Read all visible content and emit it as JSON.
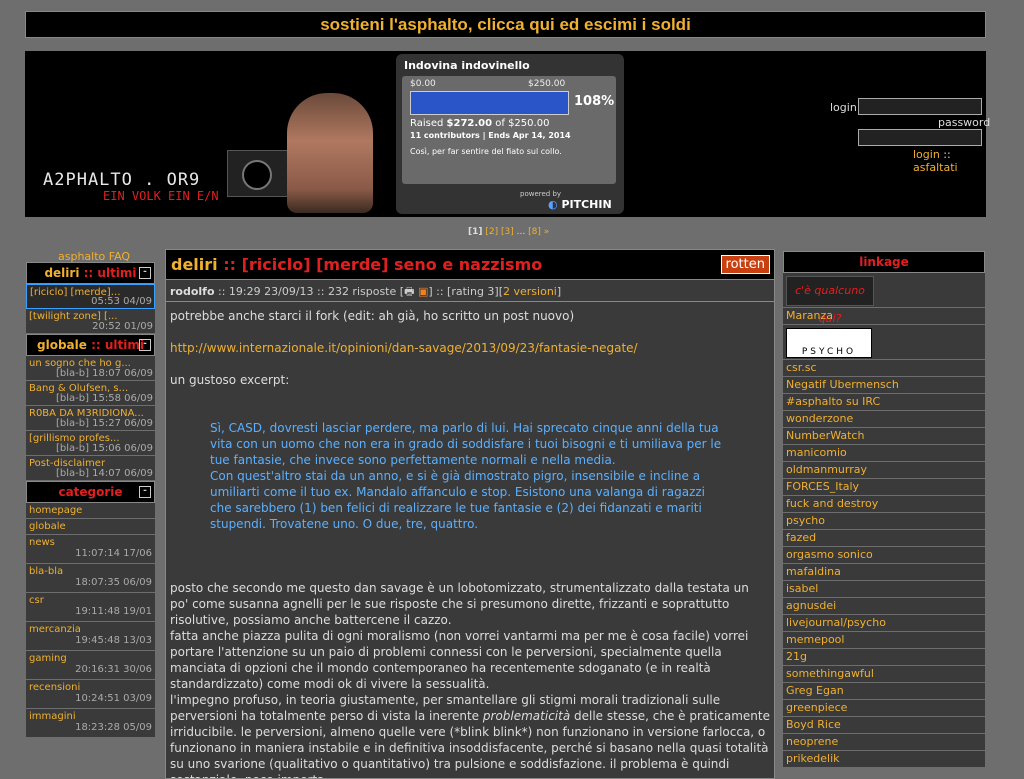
{
  "top_banner": "sostieni l'asphalto, clicca qui ed escimi i soldi",
  "logo": {
    "brand": "A2PHALTO . OR9",
    "slogan": "EIN VOLK EIN E/N"
  },
  "pitchin": {
    "title": "Indovina indovinello",
    "min": "$0.00",
    "max": "$250.00",
    "progress_percent": 108,
    "percent_label": "108%",
    "raised_prefix": "Raised ",
    "raised": "$272.00",
    "raised_suffix": " of $250.00",
    "contributors": "11 contributors | Ends Apr 14, 2014",
    "description": "Così, per far sentire del fiato sul collo.",
    "powered": "powered by",
    "brand": "PITCHIN"
  },
  "login": {
    "login_label": "login",
    "password_label": "password",
    "login_link": "login",
    "sep": " :: ",
    "register_link": "asfaltati"
  },
  "pager": {
    "current": "[1]",
    "pages": [
      "[2]",
      "[3]",
      "...",
      "[8]",
      "»"
    ]
  },
  "faq": "asphalto FAQ",
  "deliri_box": {
    "title_a": "deliri",
    "title_b": " :: ultimi",
    "items": [
      {
        "title": "[riciclo] [merde]…",
        "meta": "05:53 04/09"
      },
      {
        "title": "[twilight zone] [...",
        "meta": "20:52 01/09"
      }
    ]
  },
  "globale_box": {
    "title_a": "globale",
    "title_b": " :: ultimi",
    "items": [
      {
        "title": "un sogno che ho g...",
        "meta": "[bla-b] 18:07 06/09"
      },
      {
        "title": "Bang & Olufsen, s...",
        "meta": "[bla-b] 15:58 06/09"
      },
      {
        "title": "R0BA DA M3RIDIONA...",
        "meta": "[bla-b] 15:27 06/09"
      },
      {
        "title": "[grillismo profes...",
        "meta": "[bla-b] 15:06 06/09"
      },
      {
        "title": "Post-disclaimer",
        "meta": "[bla-b] 14:07 06/09"
      }
    ]
  },
  "categorie_box": {
    "title": "categorie",
    "items": [
      {
        "name": "homepage",
        "meta": ""
      },
      {
        "name": "globale",
        "meta": ""
      },
      {
        "name": "news",
        "meta": "11:07:14 17/06"
      },
      {
        "name": "bla-bla",
        "meta": "18:07:35 06/09"
      },
      {
        "name": "csr",
        "meta": "19:11:48 19/01"
      },
      {
        "name": "mercanzia",
        "meta": "19:45:48 13/03"
      },
      {
        "name": "gaming",
        "meta": "20:16:31 30/06"
      },
      {
        "name": "recensioni",
        "meta": "10:24:51 03/09"
      },
      {
        "name": "immagini",
        "meta": "18:23:28 05/09"
      }
    ]
  },
  "post": {
    "title_a": "deliri",
    "title_b": " :: [riciclo] [merde] seno e nazzismo",
    "rating_badge": "rotten",
    "author": "rodolfo",
    "meta": " :: 19:29 23/09/13 :: 232 risposte [",
    "meta2": "] :: [rating 3][",
    "versions": "2 versioni",
    "meta3": "]",
    "p1": "potrebbe anche starci il fork (edit: ah già, ho scritto un post nuovo)",
    "url": "http://www.internazionale.it/opinioni/dan-savage/2013/09/23/fantasie-negate/",
    "p2": "un gustoso excerpt:",
    "quote1": "Sì, CASD, dovresti lasciar perdere, ma parlo di lui. Hai sprecato cinque anni della tua vita con un uomo che non era in grado di soddisfare i tuoi bisogni e ti umiliava per le tue fantasie, che invece sono perfettamente normali e nella media.",
    "quote2": "Con quest'altro stai da un anno, e si è già dimostrato pigro, insensibile e incline a umiliarti come il tuo ex. Mandalo affanculo e stop. Esistono una valanga di ragazzi che sarebbero (1) ben felici di realizzare le tue fantasie e (2) dei fidanzati e mariti stupendi. Trovatene uno. O due, tre, quattro.",
    "p3a": "posto che secondo me questo dan savage è un lobotomizzato, strumentalizzato dalla testata un po' come susanna agnelli per le sue risposte che si presumono dirette, frizzanti e soprattutto risolutive, possiamo anche battercene il cazzo.",
    "p3b": "fatta anche piazza pulita di ogni moralismo (non vorrei vantarmi ma per me è cosa facile) vorrei portare l'attenzione su un paio di problemi connessi con le perversioni, specialmente quella manciata di opzioni che il mondo contemporaneo ha recentemente sdoganato (e in realtà standardizzato) come modi ok di vivere la sessualità.",
    "p3c_1": "l'impegno profuso, in teoria giustamente, per smantellare gli stigmi morali tradizionali sulle perversioni ha totalmente perso di vista la inerente ",
    "p3c_em": "problematicità",
    "p3c_2": " delle stesse, che è praticamente irriducibile. le perversioni, almeno quelle vere (*blink blink*) non funzionano in versione farlocca, o funzionano in maniera instabile e in definitiva insoddisfacente, perché si basano nella quasi totalità su uno svarione (qualitativo o quantitativo) tra pulsione e soddisfazione. il problema è quindi sostanziale, poco importa"
  },
  "linkage": {
    "title": "linkage",
    "banner1": "c'è qualcuno qui?",
    "banner2": "PSYCHO",
    "links": [
      "Maranza",
      "csr.sc",
      "Negatif Ubermensch",
      "#asphalto su IRC",
      "wonderzone",
      "NumberWatch",
      "manicomio",
      "oldmanmurray",
      "FORCES_Italy",
      "fuck and destroy",
      "psycho",
      "fazed",
      "orgasmo sonico",
      "mafaldina",
      "isabel",
      "agnusdei",
      "livejournal/psycho",
      "memepool",
      "21g",
      "somethingawful",
      "Greg Egan",
      "greenpiece",
      "Boyd Rice",
      "neoprene",
      "prikedelik"
    ]
  },
  "colors": {
    "accent": "#f0b030",
    "red": "#e02020",
    "quote": "#5ab0ff"
  }
}
